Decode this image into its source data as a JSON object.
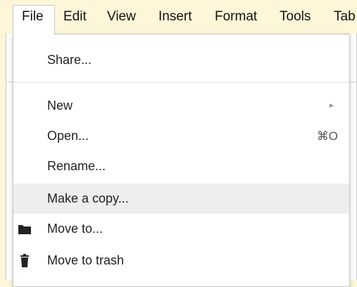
{
  "colors": {
    "background": "#fdf6d8",
    "menu_bg": "#ffffff",
    "hover_bg": "#eeeeee",
    "text": "#222222",
    "border": "#c8c8c8"
  },
  "menubar": {
    "items": [
      {
        "label": "File",
        "active": true
      },
      {
        "label": "Edit"
      },
      {
        "label": "View"
      },
      {
        "label": "Insert"
      },
      {
        "label": "Format"
      },
      {
        "label": "Tools"
      },
      {
        "label": "Tab"
      }
    ]
  },
  "file_menu": {
    "items": [
      {
        "label": "Share..."
      },
      {
        "label": "New",
        "submenu": true,
        "arrow": "►"
      },
      {
        "label": "Open...",
        "shortcut": "⌘O"
      },
      {
        "label": "Rename..."
      },
      {
        "label": "Make a copy...",
        "highlighted": true
      },
      {
        "label": "Move to...",
        "icon": "folder-icon"
      },
      {
        "label": "Move to trash",
        "icon": "trash-icon"
      }
    ]
  }
}
